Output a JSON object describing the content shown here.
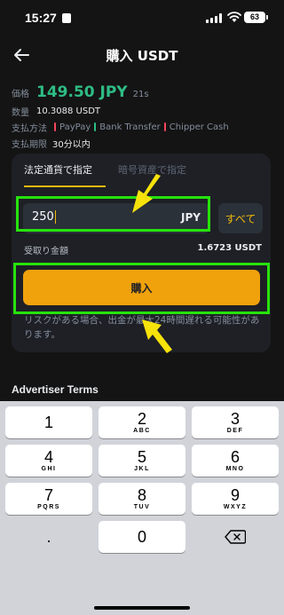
{
  "status_bar": {
    "time": "15:27",
    "battery": "63"
  },
  "header": {
    "title": "購入 USDT"
  },
  "info": {
    "price_label": "価格",
    "price": "149.50 JPY",
    "timer": "21s",
    "quantity_label": "数量",
    "quantity": "10.3088 USDT",
    "payment_label": "支払方法",
    "payment_methods": [
      {
        "name": "PayPay",
        "color": "#f6465d"
      },
      {
        "name": "Bank Transfer",
        "color": "#2ebd85"
      },
      {
        "name": "Chipper Cash",
        "color": "#f6465d"
      }
    ],
    "deadline_label": "支払期限",
    "deadline": "30分以内"
  },
  "tabs": {
    "fiat": "法定通貨で指定",
    "crypto": "暗号資産で指定"
  },
  "amount_input": {
    "value": "250",
    "currency": "JPY"
  },
  "all_button": "すべて",
  "receive": {
    "label": "受取り金額",
    "value": "1.6723 USDT"
  },
  "buy_button": "購入",
  "risk_notice": "リスクがある場合、出金が最大24時間遅れる可能性があります。",
  "advertiser_terms": "Advertiser Terms",
  "keyboard": {
    "keys": [
      {
        "digit": "1",
        "letters": ""
      },
      {
        "digit": "2",
        "letters": "ABC"
      },
      {
        "digit": "3",
        "letters": "DEF"
      },
      {
        "digit": "4",
        "letters": "GHI"
      },
      {
        "digit": "5",
        "letters": "JKL"
      },
      {
        "digit": "6",
        "letters": "MNO"
      },
      {
        "digit": "7",
        "letters": "PQRS"
      },
      {
        "digit": "8",
        "letters": "TUV"
      },
      {
        "digit": "9",
        "letters": "WXYZ"
      }
    ],
    "dot": ".",
    "zero": "0"
  },
  "colors": {
    "accent": "#f0b90b",
    "highlight": "#26e30c",
    "price": "#2ebd85"
  }
}
